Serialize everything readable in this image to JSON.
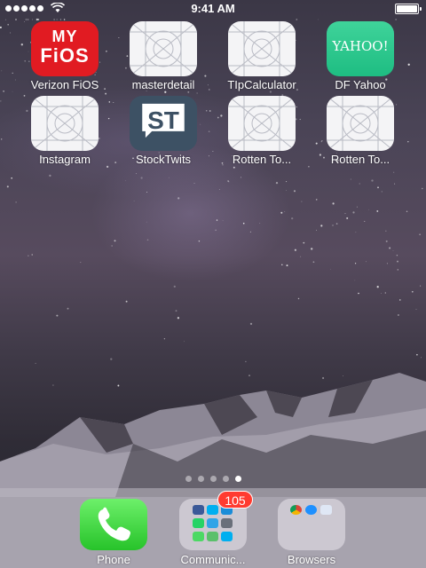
{
  "status_bar": {
    "time": "9:41 AM",
    "signal_dots": 5,
    "battery_level": 1.0
  },
  "home_screen": {
    "apps": [
      {
        "id": "verizon-fios",
        "label": "Verizon FiOS",
        "icon_text_top": "MY",
        "icon_text_bottom": "FiOS",
        "icon": "fios-logo",
        "color": "#e11b22"
      },
      {
        "id": "masterdetail",
        "label": "masterdetail",
        "icon": "placeholder-grid-icon"
      },
      {
        "id": "tipcalculator",
        "label": "TIpCalculator",
        "icon": "placeholder-grid-icon"
      },
      {
        "id": "df-yahoo",
        "label": "DF Yahoo",
        "icon_text": "YAHOO!",
        "icon": "yahoo-logo",
        "color": "#2bc88c"
      },
      {
        "id": "instagram",
        "label": "Instagram",
        "icon": "placeholder-grid-icon"
      },
      {
        "id": "stocktwits",
        "label": "StockTwits",
        "icon_text": "ST",
        "icon": "stocktwits-logo",
        "color": "#3d5164"
      },
      {
        "id": "rotten-tomatoes-1",
        "label": "Rotten To...",
        "icon": "placeholder-grid-icon"
      },
      {
        "id": "rotten-tomatoes-2",
        "label": "Rotten To...",
        "icon": "placeholder-grid-icon"
      }
    ],
    "page_count": 5,
    "current_page": 5
  },
  "dock": {
    "apps": [
      {
        "id": "phone",
        "label": "Phone",
        "icon": "phone-icon",
        "color": "#2fcc32"
      },
      {
        "id": "communication",
        "label": "Communic...",
        "icon": "folder-icon",
        "badge": "105"
      },
      {
        "id": "browsers",
        "label": "Browsers",
        "icon": "folder-icon"
      }
    ]
  },
  "colors": {
    "badge": "#ff3b30",
    "page_dot_active": "#ffffff"
  }
}
